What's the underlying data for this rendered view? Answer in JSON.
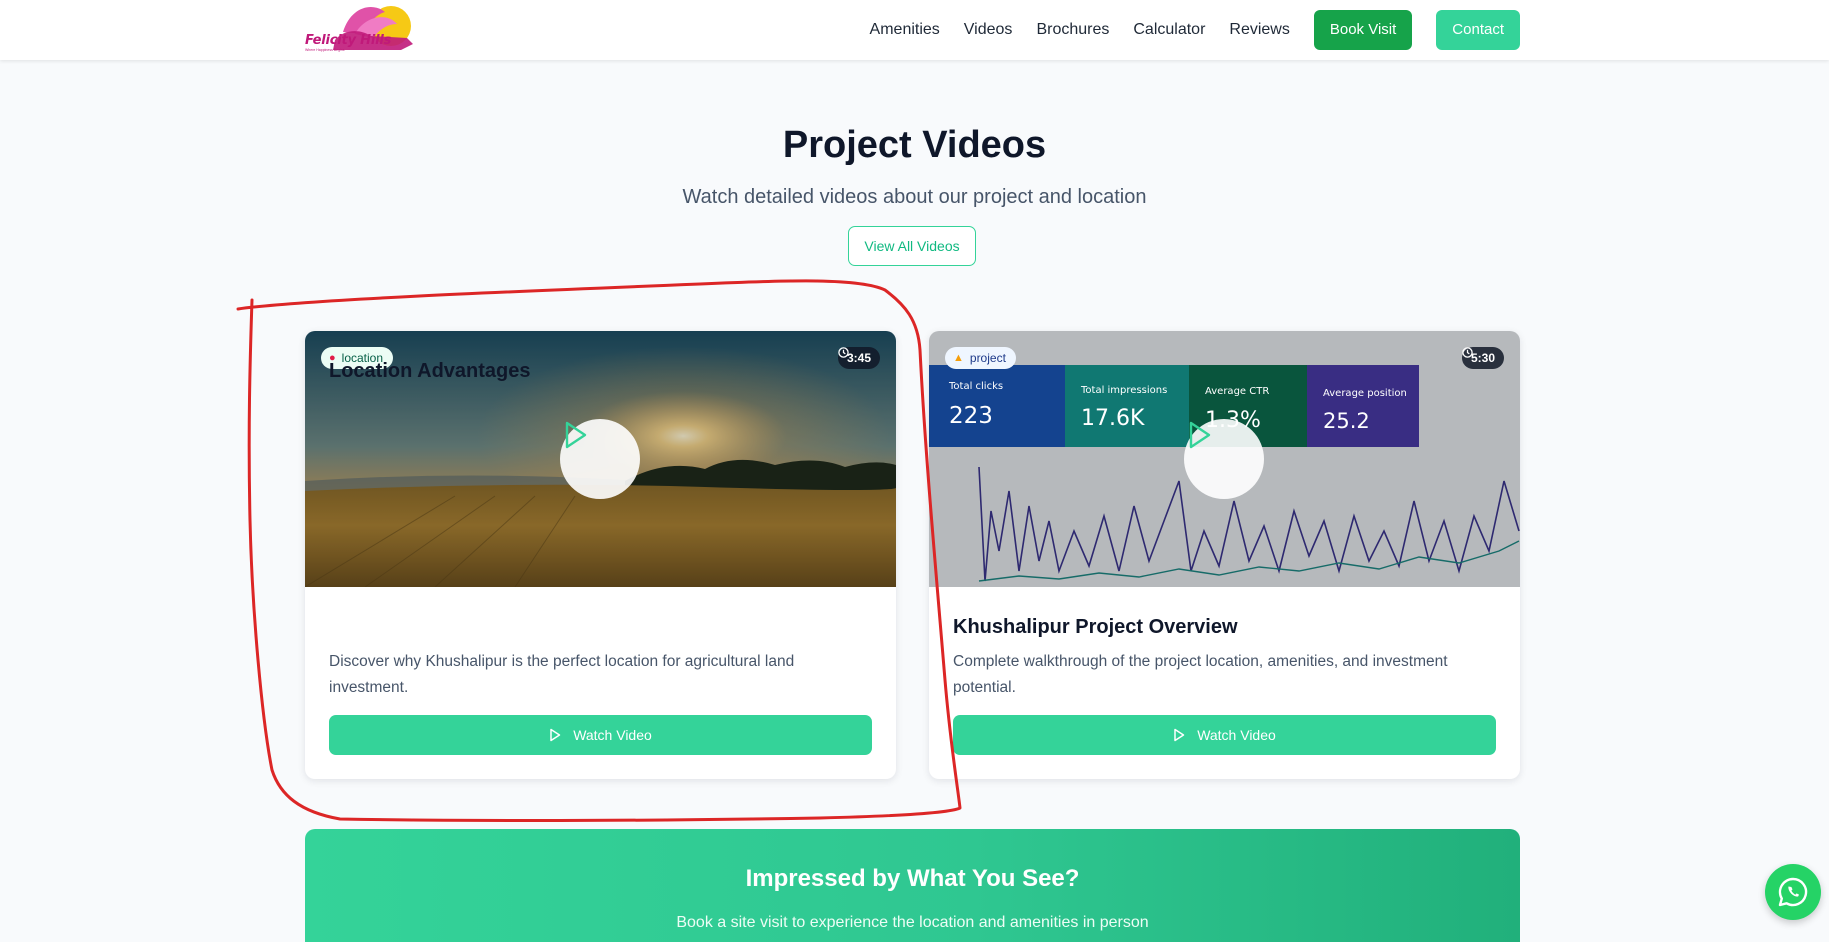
{
  "header": {
    "logo_text": "Felicity Hills",
    "logo_tagline": "Where Happiness Begins",
    "nav": [
      "Amenities",
      "Videos",
      "Brochures",
      "Calculator",
      "Reviews"
    ],
    "book_visit": "Book Visit",
    "contact": "Contact"
  },
  "section": {
    "title": "Project Videos",
    "subtitle": "Watch detailed videos about our project and location",
    "view_all": "View All Videos"
  },
  "videos": [
    {
      "category": "location",
      "category_icon": "pin-icon",
      "duration": "3:45",
      "title": "Location Advantages",
      "description": "Discover why Khushalipur is the perfect location for agricultural land investment.",
      "button": "Watch Video"
    },
    {
      "category": "project",
      "category_icon": "construction-icon",
      "duration": "5:30",
      "title": "Khushalipur Project Overview",
      "description": "Complete walkthrough of the project location, amenities, and investment potential.",
      "button": "Watch Video",
      "thumbnail_metrics": [
        {
          "label": "Total clicks",
          "value": "223"
        },
        {
          "label": "Total impressions",
          "value": "17.6K"
        },
        {
          "label": "Average CTR",
          "value": "1.3%"
        },
        {
          "label": "Average position",
          "value": "25.2"
        }
      ]
    }
  ],
  "cta": {
    "title": "Impressed by What You See?",
    "subtitle": "Book a site visit to experience the location and amenities in person"
  },
  "colors": {
    "accent": "#34d399",
    "book_visit": "#16a34a",
    "annotation": "#dc2626",
    "whatsapp": "#25d366"
  }
}
